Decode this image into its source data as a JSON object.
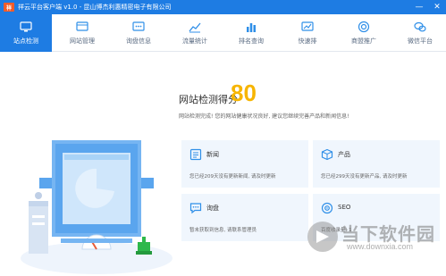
{
  "window": {
    "logo_text": "祥",
    "title": "祥云平台客户端 v1.0 - 昆山博杰利惠精密电子有限公司"
  },
  "nav": {
    "items": [
      {
        "label": "站点检测",
        "icon": "monitor-icon",
        "active": true
      },
      {
        "label": "网站管理",
        "icon": "website-manage-icon",
        "active": false
      },
      {
        "label": "询盘信息",
        "icon": "inquiry-icon",
        "active": false
      },
      {
        "label": "流量统计",
        "icon": "traffic-chart-icon",
        "active": false
      },
      {
        "label": "排名查询",
        "icon": "ranking-icon",
        "active": false
      },
      {
        "label": "快速排",
        "icon": "fast-rank-icon",
        "active": false
      },
      {
        "label": "商盟推广",
        "icon": "promotion-icon",
        "active": false
      },
      {
        "label": "微信平台",
        "icon": "wechat-icon",
        "active": false
      }
    ]
  },
  "score": {
    "title": "网站检测得分",
    "value": "80",
    "description": "网站检测完成! 您的网站健康状况良好, 建议您继续完善产品和新闻信息!"
  },
  "cards": [
    {
      "title": "新闻",
      "description": "您已经209天没有更新新闻, 请及时更新",
      "icon": "news-icon"
    },
    {
      "title": "产品",
      "description": "您已经299天没有更新产品, 请及时更新",
      "icon": "product-box-icon"
    },
    {
      "title": "询盘",
      "description": "暂未获取到信息, 请联系管理员",
      "icon": "chat-bubble-icon"
    },
    {
      "title": "SEO",
      "description": "百度收录量: 1",
      "icon": "seo-target-icon"
    }
  ],
  "watermark": {
    "text": "当下软件园",
    "url": "www.downxia.com"
  },
  "colors": {
    "primary": "#1e7ce3",
    "score": "#f7b500",
    "card_bg": "#f0f6fd"
  }
}
